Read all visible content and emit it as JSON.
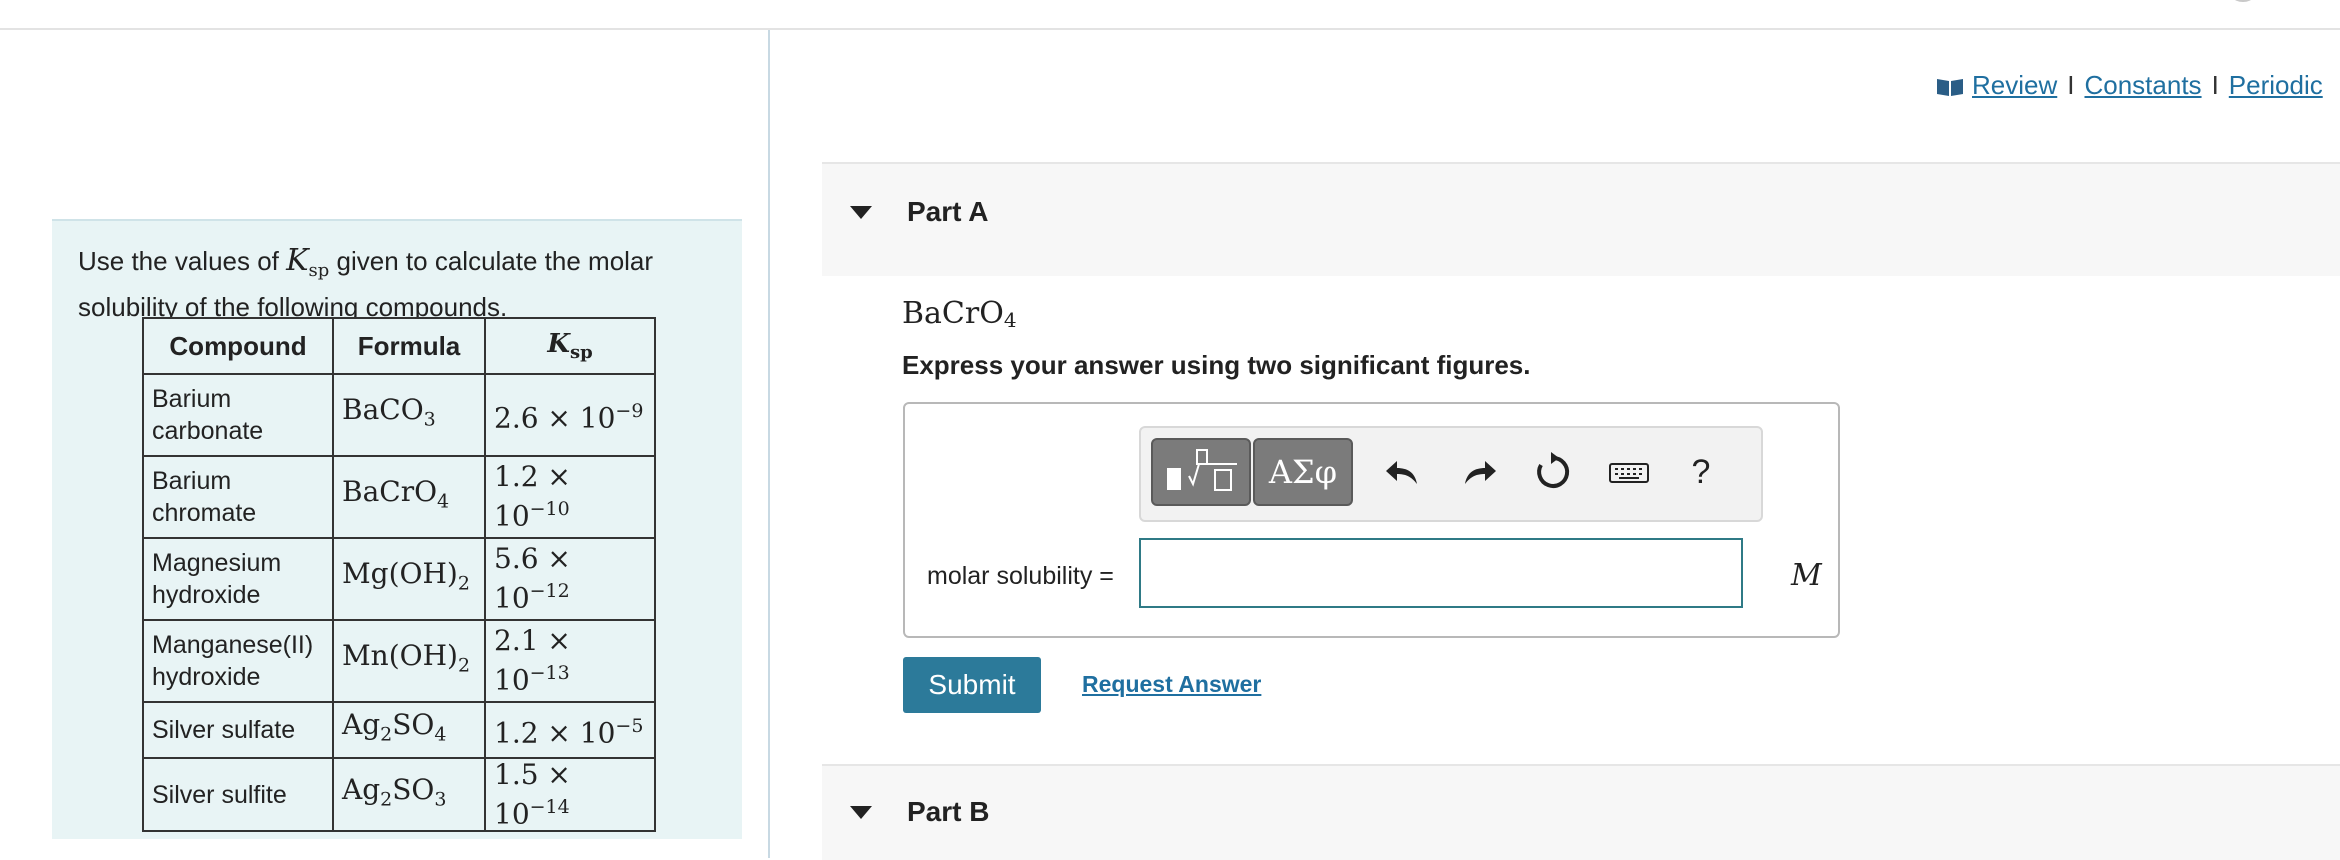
{
  "problem": {
    "intro_pre": "Use the values of",
    "intro_ksp_main": "K",
    "intro_ksp_sub": "sp",
    "intro_post": "given to calculate the molar solubility of the following compounds.",
    "table": {
      "headers": [
        "Compound",
        "Formula",
        "Ksp"
      ],
      "rows": [
        {
          "compound": "Barium carbonate",
          "formula": "BaCO3",
          "ksp": "2.6 × 10−9"
        },
        {
          "compound": "Barium chromate",
          "formula": "BaCrO4",
          "ksp": "1.2 × 10−10"
        },
        {
          "compound": "Magnesium hydroxide",
          "formula": "Mg(OH)2",
          "ksp": "5.6 × 10−12"
        },
        {
          "compound": "Manganese(II) hydroxide",
          "formula": "Mn(OH)2",
          "ksp": "2.1 × 10−13"
        },
        {
          "compound": "Silver sulfate",
          "formula": "Ag2SO4",
          "ksp": "1.2 × 10−5"
        },
        {
          "compound": "Silver sulfite",
          "formula": "Ag2SO3",
          "ksp": "1.5 × 10−14"
        }
      ]
    }
  },
  "links": {
    "review": "Review",
    "constants": "Constants",
    "periodic": "Periodic",
    "separator": "I"
  },
  "partA": {
    "title": "Part A",
    "formula": "BaCrO4",
    "instruction": "Express your answer using two significant figures.",
    "toolbar": {
      "greek_label": "ΑΣφ",
      "help_label": "?"
    },
    "answer_label": "molar solubility =",
    "answer_value": "",
    "unit": "M",
    "submit_label": "Submit",
    "request_label": "Request Answer"
  },
  "partB": {
    "title": "Part B"
  }
}
